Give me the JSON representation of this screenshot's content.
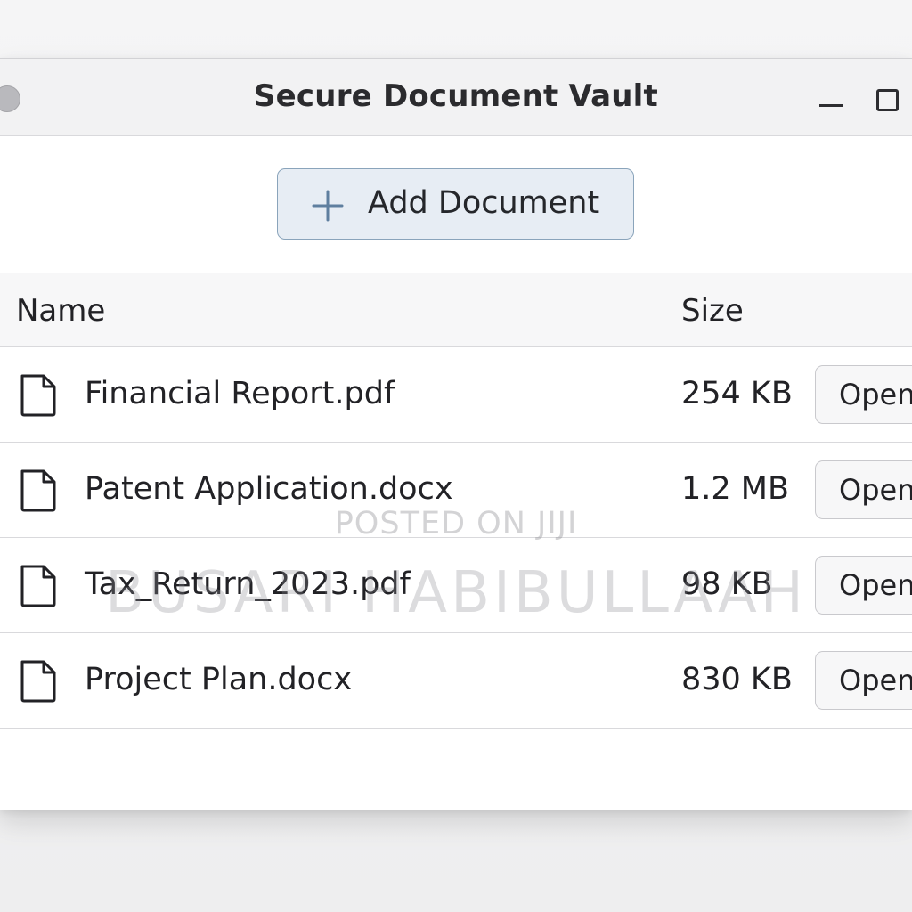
{
  "window": {
    "title": "Secure Document Vault"
  },
  "toolbar": {
    "add_label": "Add Document",
    "add_icon": "plus-icon",
    "accent_color": "#8aa4bb"
  },
  "table": {
    "columns": [
      "Name",
      "Size"
    ],
    "rows": [
      {
        "name": "Financial Report.pdf",
        "size": "254 KB",
        "action": "Open",
        "icon": "file-icon"
      },
      {
        "name": "Patent Application.docx",
        "size": "1.2 MB",
        "action": "Open",
        "icon": "file-icon"
      },
      {
        "name": "Tax_Return_2023.pdf",
        "size": "98 KB",
        "action": "Open",
        "icon": "file-icon"
      },
      {
        "name": "Project Plan.docx",
        "size": "830 KB",
        "action": "Open",
        "icon": "file-icon"
      }
    ]
  },
  "watermark": {
    "small": "POSTED ON JIJI",
    "large": "BUSARI HABIBULLAAH"
  }
}
